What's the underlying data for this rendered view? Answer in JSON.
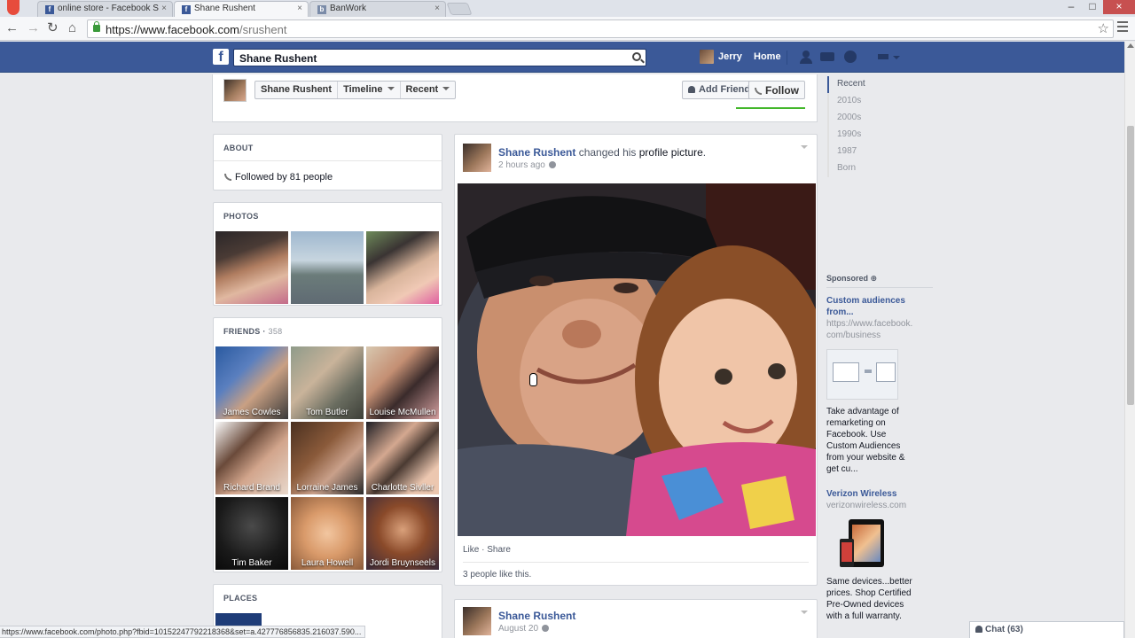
{
  "browser": {
    "tabs": [
      {
        "title": "online store - Facebook S",
        "active": false
      },
      {
        "title": "Shane Rushent",
        "active": true
      },
      {
        "title": "BanWork",
        "active": false
      }
    ],
    "url_host": "https://www.facebook.com",
    "url_path": "/srushent",
    "status_url": "https://www.facebook.com/photo.php?fbid=10152247792218368&set=a.427776856835.216037.590..."
  },
  "fb": {
    "search_value": "Shane Rushent",
    "user_name": "Jerry",
    "home_label": "Home"
  },
  "profile": {
    "crumbs": [
      "Shane Rushent",
      "Timeline",
      "Recent"
    ],
    "add_friend_label": "Add Friend",
    "follow_label": "Follow"
  },
  "about": {
    "title": "ABOUT",
    "followed_prefix": "Followed by ",
    "followed_count": "81 people"
  },
  "photos": {
    "title": "PHOTOS"
  },
  "friends": {
    "title": "FRIENDS",
    "count": "358",
    "items": [
      {
        "name": "James Cowles"
      },
      {
        "name": "Tom Butler"
      },
      {
        "name": "Louise McMullen"
      },
      {
        "name": "Richard Brand"
      },
      {
        "name": "Lorraine James"
      },
      {
        "name": "Charlotte Sivller"
      },
      {
        "name": "Tim Baker"
      },
      {
        "name": "Laura Howell"
      },
      {
        "name": "Jordi Bruynseels"
      }
    ]
  },
  "places": {
    "title": "PLACES"
  },
  "post": {
    "author": "Shane Rushent",
    "action_prefix": " changed his ",
    "action_link": "profile picture",
    "action_suffix": ".",
    "time": "2 hours ago",
    "actions": "Like · Share",
    "likes": "3 people like this."
  },
  "post2": {
    "author": "Shane Rushent",
    "time": "August 20"
  },
  "timeline_years": [
    "Recent",
    "2010s",
    "2000s",
    "1990s",
    "1987",
    "Born"
  ],
  "sponsored": {
    "label": "Sponsored",
    "ad1": {
      "title_l1": "Custom audiences",
      "title_l2": "from...",
      "url_l1": "https://www.facebook.",
      "url_l2": "com/business",
      "text": [
        "Take advantage of",
        "remarketing on",
        "Facebook. Use",
        "Custom Audiences",
        "from your website &",
        "get cu..."
      ]
    },
    "ad2": {
      "title": "Verizon Wireless",
      "url": "verizonwireless.com",
      "text": [
        "Same devices...better",
        "prices. Shop Certified",
        "Pre-Owned devices",
        "with a full warranty."
      ]
    }
  },
  "chat": {
    "label": "Chat (63)"
  },
  "colors": {
    "fb_blue": "#3b5998",
    "link_blue": "#3b5998",
    "green": "#42b72a"
  }
}
